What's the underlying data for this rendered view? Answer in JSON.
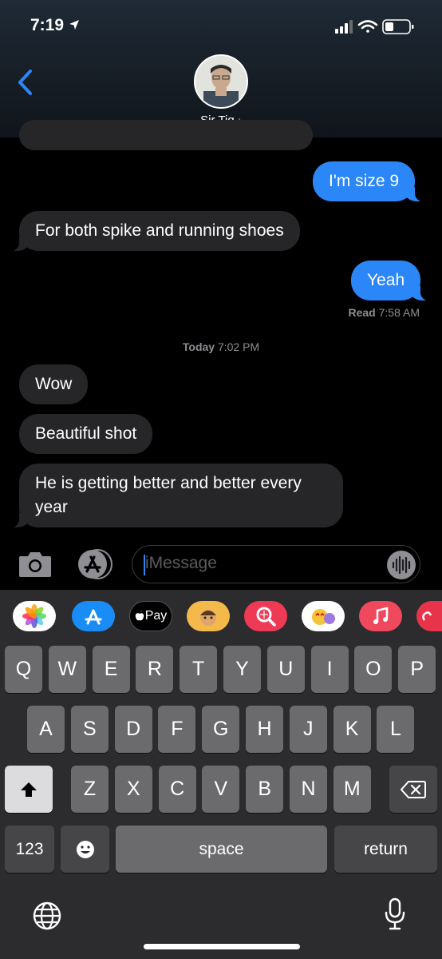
{
  "status_bar": {
    "time": "7:19"
  },
  "contact": {
    "name": "Sir Tig",
    "chevron": "›"
  },
  "messages": [
    {
      "text": "I'm size 9",
      "dir": "out"
    },
    {
      "text": "For both spike and running shoes",
      "dir": "in"
    },
    {
      "text": "Yeah",
      "dir": "out"
    },
    {
      "text": "Wow",
      "dir": "in"
    },
    {
      "text": "Beautiful shot",
      "dir": "in"
    },
    {
      "text": "He is getting better and better every year",
      "dir": "in"
    }
  ],
  "read_receipt": {
    "label": "Read",
    "time": "7:58 AM"
  },
  "timestamp": {
    "day": "Today",
    "time": "7:02 PM"
  },
  "compose": {
    "placeholder": "iMessage"
  },
  "app_strip": {
    "apple_pay_label": "Pay",
    "icons": [
      "photos-icon",
      "app-store-icon",
      "apple-pay-icon",
      "memoji-icon",
      "search-images-icon",
      "animoji-stickers-icon",
      "music-icon",
      "digital-touch-icon"
    ]
  },
  "keyboard": {
    "row1": [
      "Q",
      "W",
      "E",
      "R",
      "T",
      "Y",
      "U",
      "I",
      "O",
      "P"
    ],
    "row2": [
      "A",
      "S",
      "D",
      "F",
      "G",
      "H",
      "J",
      "K",
      "L"
    ],
    "row3": [
      "Z",
      "X",
      "C",
      "V",
      "B",
      "N",
      "M"
    ],
    "numbers_label": "123",
    "space_label": "space",
    "return_label": "return"
  },
  "colors": {
    "sent_bubble": "#2b86f7",
    "received_bubble": "#262629",
    "keyboard_bg": "#2c2c2e"
  }
}
